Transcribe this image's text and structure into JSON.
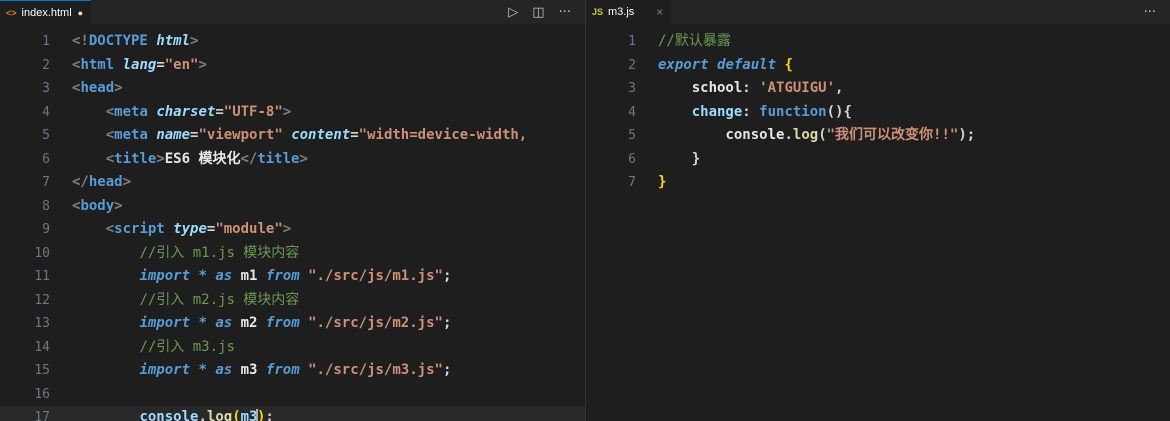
{
  "left_pane": {
    "tab": {
      "icon": "html-file-icon",
      "icon_glyph": "<>",
      "name": "index.html",
      "dirty_glyph": "●"
    },
    "actions": [
      {
        "name": "run-icon",
        "glyph": "▷"
      },
      {
        "name": "split-editor-icon",
        "glyph": "◫"
      },
      {
        "name": "more-actions-icon",
        "glyph": "···"
      }
    ],
    "lines": [
      {
        "n": "1",
        "tokens": [
          [
            "t-brk",
            "<!"
          ],
          [
            "t-tag",
            "DOCTYPE"
          ],
          [
            "t-op",
            " "
          ],
          [
            "t-attr",
            "html"
          ],
          [
            "t-brk",
            ">"
          ]
        ]
      },
      {
        "n": "2",
        "tokens": [
          [
            "t-brk",
            "<"
          ],
          [
            "t-tag",
            "html"
          ],
          [
            "t-op",
            " "
          ],
          [
            "t-attr",
            "lang"
          ],
          [
            "t-op",
            "="
          ],
          [
            "t-str",
            "\"en\""
          ],
          [
            "t-brk",
            ">"
          ]
        ]
      },
      {
        "n": "3",
        "tokens": [
          [
            "t-brk",
            "<"
          ],
          [
            "t-tag",
            "head"
          ],
          [
            "t-brk",
            ">"
          ]
        ]
      },
      {
        "n": "4",
        "tokens": [
          [
            "t-op",
            "    "
          ],
          [
            "t-brk",
            "<"
          ],
          [
            "t-tag",
            "meta"
          ],
          [
            "t-op",
            " "
          ],
          [
            "t-attr",
            "charset"
          ],
          [
            "t-op",
            "="
          ],
          [
            "t-str",
            "\"UTF-8\""
          ],
          [
            "t-brk",
            ">"
          ]
        ]
      },
      {
        "n": "5",
        "tokens": [
          [
            "t-op",
            "    "
          ],
          [
            "t-brk",
            "<"
          ],
          [
            "t-tag",
            "meta"
          ],
          [
            "t-op",
            " "
          ],
          [
            "t-attr",
            "name"
          ],
          [
            "t-op",
            "="
          ],
          [
            "t-str",
            "\"viewport\""
          ],
          [
            "t-op",
            " "
          ],
          [
            "t-attr",
            "content"
          ],
          [
            "t-op",
            "="
          ],
          [
            "t-str",
            "\"width=device-width,"
          ]
        ]
      },
      {
        "n": "6",
        "tokens": [
          [
            "t-op",
            "    "
          ],
          [
            "t-brk",
            "<"
          ],
          [
            "t-tag",
            "title"
          ],
          [
            "t-brk",
            ">"
          ],
          [
            "t-ident",
            "ES6 模块化"
          ],
          [
            "t-brk",
            "</"
          ],
          [
            "t-tag",
            "title"
          ],
          [
            "t-brk",
            ">"
          ]
        ]
      },
      {
        "n": "7",
        "tokens": [
          [
            "t-brk",
            "</"
          ],
          [
            "t-tag",
            "head"
          ],
          [
            "t-brk",
            ">"
          ]
        ]
      },
      {
        "n": "8",
        "tokens": [
          [
            "t-brk",
            "<"
          ],
          [
            "t-tag",
            "body"
          ],
          [
            "t-brk",
            ">"
          ]
        ]
      },
      {
        "n": "9",
        "tokens": [
          [
            "t-op",
            "    "
          ],
          [
            "t-brk",
            "<"
          ],
          [
            "t-tag",
            "script"
          ],
          [
            "t-op",
            " "
          ],
          [
            "t-attr",
            "type"
          ],
          [
            "t-op",
            "="
          ],
          [
            "t-str",
            "\"module\""
          ],
          [
            "t-brk",
            ">"
          ]
        ]
      },
      {
        "n": "10",
        "tokens": [
          [
            "t-op",
            "        "
          ],
          [
            "t-cmt",
            "//引入 m1.js 模块内容"
          ]
        ]
      },
      {
        "n": "11",
        "tokens": [
          [
            "t-op",
            "        "
          ],
          [
            "t-kwi",
            "import"
          ],
          [
            "t-op",
            " "
          ],
          [
            "t-kw",
            "*"
          ],
          [
            "t-op",
            " "
          ],
          [
            "t-kwi",
            "as"
          ],
          [
            "t-op",
            " "
          ],
          [
            "t-ident",
            "m1"
          ],
          [
            "t-op",
            " "
          ],
          [
            "t-kwi",
            "from"
          ],
          [
            "t-op",
            " "
          ],
          [
            "t-str",
            "\"./src/js/m1.js\""
          ],
          [
            "t-op",
            ";"
          ]
        ]
      },
      {
        "n": "12",
        "tokens": [
          [
            "t-op",
            "        "
          ],
          [
            "t-cmt",
            "//引入 m2.js 模块内容"
          ]
        ]
      },
      {
        "n": "13",
        "tokens": [
          [
            "t-op",
            "        "
          ],
          [
            "t-kwi",
            "import"
          ],
          [
            "t-op",
            " "
          ],
          [
            "t-kw",
            "*"
          ],
          [
            "t-op",
            " "
          ],
          [
            "t-kwi",
            "as"
          ],
          [
            "t-op",
            " "
          ],
          [
            "t-ident",
            "m2"
          ],
          [
            "t-op",
            " "
          ],
          [
            "t-kwi",
            "from"
          ],
          [
            "t-op",
            " "
          ],
          [
            "t-str",
            "\"./src/js/m2.js\""
          ],
          [
            "t-op",
            ";"
          ]
        ]
      },
      {
        "n": "14",
        "tokens": [
          [
            "t-op",
            "        "
          ],
          [
            "t-cmt",
            "//引入 m3.js"
          ]
        ]
      },
      {
        "n": "15",
        "tokens": [
          [
            "t-op",
            "        "
          ],
          [
            "t-kwi",
            "import"
          ],
          [
            "t-op",
            " "
          ],
          [
            "t-kw",
            "*"
          ],
          [
            "t-op",
            " "
          ],
          [
            "t-kwi",
            "as"
          ],
          [
            "t-op",
            " "
          ],
          [
            "t-ident",
            "m3"
          ],
          [
            "t-op",
            " "
          ],
          [
            "t-kwi",
            "from"
          ],
          [
            "t-op",
            " "
          ],
          [
            "t-str",
            "\"./src/js/m3.js\""
          ],
          [
            "t-op",
            ";"
          ]
        ]
      },
      {
        "n": "16",
        "tokens": []
      },
      {
        "n": "17",
        "current": true,
        "tokens": [
          [
            "t-op",
            "        "
          ],
          [
            "t-var",
            "console"
          ],
          [
            "t-op",
            "."
          ],
          [
            "t-fn",
            "log"
          ],
          [
            "t-yellow",
            "("
          ],
          [
            "t-var",
            "m3"
          ],
          [
            "caret",
            ""
          ],
          [
            "t-yellow",
            ")"
          ],
          [
            "t-op",
            ";"
          ]
        ]
      }
    ]
  },
  "right_pane": {
    "tab": {
      "icon": "js-file-icon",
      "icon_glyph": "JS",
      "name": "m3.js",
      "close_glyph": "×"
    },
    "actions": [
      {
        "name": "more-actions-icon",
        "glyph": "···"
      }
    ],
    "lines": [
      {
        "n": "1",
        "tokens": [
          [
            "t-cmt",
            "//默认暴露"
          ]
        ]
      },
      {
        "n": "2",
        "tokens": [
          [
            "t-kwi",
            "export"
          ],
          [
            "t-op",
            " "
          ],
          [
            "t-kwi",
            "default"
          ],
          [
            "t-op",
            " "
          ],
          [
            "t-yellow",
            "{"
          ]
        ]
      },
      {
        "n": "3",
        "tokens": [
          [
            "t-op",
            "    "
          ],
          [
            "t-ident",
            "school"
          ],
          [
            "t-op",
            ": "
          ],
          [
            "t-str",
            "'ATGUIGU'"
          ],
          [
            "t-op",
            ","
          ]
        ]
      },
      {
        "n": "4",
        "tokens": [
          [
            "t-op",
            "    "
          ],
          [
            "t-var",
            "change"
          ],
          [
            "t-op",
            ": "
          ],
          [
            "t-kw",
            "function"
          ],
          [
            "t-op",
            "(){"
          ]
        ]
      },
      {
        "n": "5",
        "tokens": [
          [
            "t-op",
            "        "
          ],
          [
            "t-ident",
            "console"
          ],
          [
            "t-op",
            "."
          ],
          [
            "t-fn",
            "log"
          ],
          [
            "t-op",
            "("
          ],
          [
            "t-str",
            "\"我们可以改变你!!\""
          ],
          [
            "t-op",
            ");"
          ]
        ]
      },
      {
        "n": "6",
        "tokens": [
          [
            "t-op",
            "    "
          ],
          [
            "t-op",
            "}"
          ]
        ]
      },
      {
        "n": "7",
        "tokens": [
          [
            "t-yellow",
            "}"
          ]
        ]
      }
    ]
  }
}
